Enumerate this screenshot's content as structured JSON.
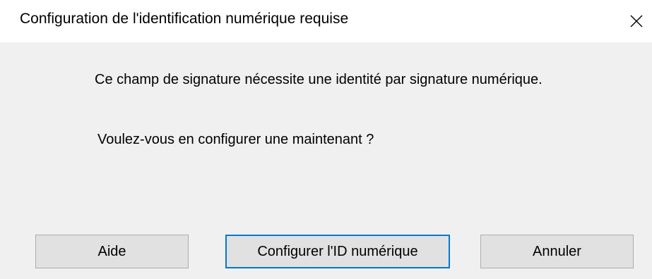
{
  "window": {
    "title": "Configuration de l'identification numérique requise",
    "close_glyph": "✕"
  },
  "content": {
    "message": "Ce champ de signature nécessite une identité par signature numérique.",
    "question": "Voulez-vous en configurer une maintenant ?"
  },
  "buttons": {
    "help_label": "Aide",
    "configure_label": "Configurer l'ID numérique",
    "cancel_label": "Annuler"
  },
  "colors": {
    "body_background": "#f0f0f0",
    "button_background": "#e1e1e1",
    "default_button_border": "#0078d7"
  }
}
